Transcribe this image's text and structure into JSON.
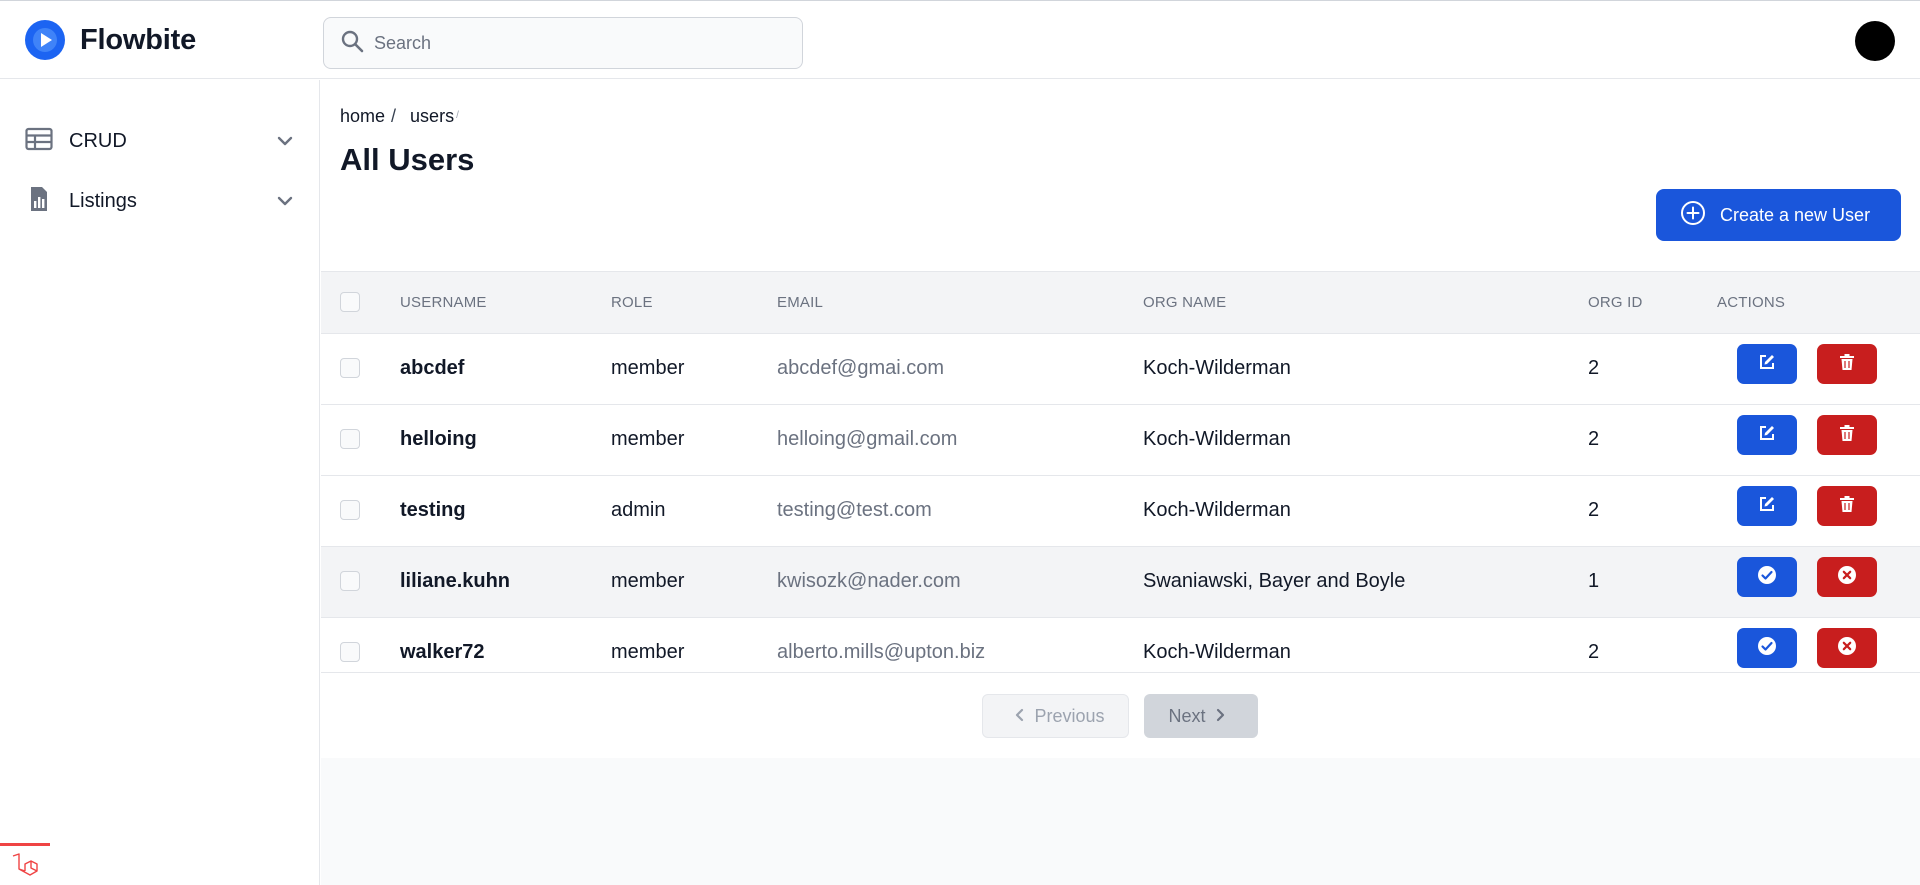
{
  "header": {
    "brand": "Flowbite",
    "search_placeholder": "Search"
  },
  "sidebar": {
    "items": [
      {
        "label": "CRUD",
        "icon": "table-icon"
      },
      {
        "label": "Listings",
        "icon": "chart-document-icon"
      }
    ]
  },
  "breadcrumb": {
    "home": "home",
    "separator": "/",
    "current": "users"
  },
  "page": {
    "title": "All Users",
    "create_button": "Create a new User"
  },
  "table": {
    "columns": [
      "USERNAME",
      "ROLE",
      "EMAIL",
      "ORG NAME",
      "ORG ID",
      "ACTIONS"
    ],
    "rows": [
      {
        "username": "abcdef",
        "role": "member",
        "email": "abcdef@gmai.com",
        "org_name": "Koch-Wilderman",
        "org_id": "2",
        "actions": [
          "edit-icon",
          "trash-icon"
        ]
      },
      {
        "username": "helloing",
        "role": "member",
        "email": "helloing@gmail.com",
        "org_name": "Koch-Wilderman",
        "org_id": "2",
        "actions": [
          "edit-icon",
          "trash-icon"
        ]
      },
      {
        "username": "testing",
        "role": "admin",
        "email": "testing@test.com",
        "org_name": "Koch-Wilderman",
        "org_id": "2",
        "actions": [
          "edit-icon",
          "trash-icon"
        ]
      },
      {
        "username": "liliane.kuhn",
        "role": "member",
        "email": "kwisozk@nader.com",
        "org_name": "Swaniawski, Bayer and Boyle",
        "org_id": "1",
        "actions": [
          "check-circle-icon",
          "x-circle-icon"
        ]
      },
      {
        "username": "walker72",
        "role": "member",
        "email": "alberto.mills@upton.biz",
        "org_name": "Koch-Wilderman",
        "org_id": "2",
        "actions": [
          "check-circle-icon",
          "x-circle-icon"
        ]
      }
    ]
  },
  "pagination": {
    "previous": "Previous",
    "next": "Next"
  },
  "colors": {
    "primary": "#1a56db",
    "danger": "#c81e1e",
    "header_bg": "#f3f4f6"
  }
}
